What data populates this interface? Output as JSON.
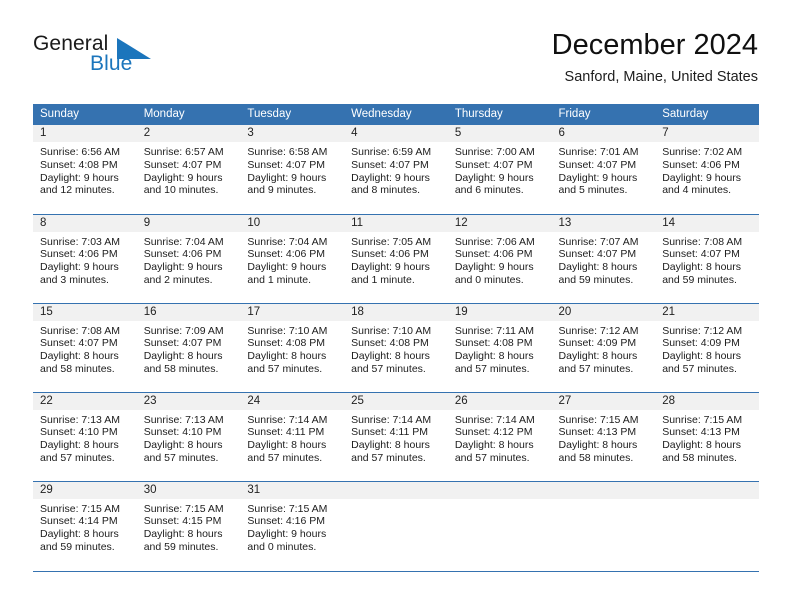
{
  "brand": {
    "name_part1": "General",
    "name_part2": "Blue",
    "mark": "triangle-logo-icon"
  },
  "header": {
    "month_title": "December 2024",
    "location": "Sanford, Maine, United States"
  },
  "colors": {
    "header_blue": "#3572b0",
    "band_gray": "#f1f1f1",
    "brand_blue": "#1b75bc",
    "text": "#1c1c1c"
  },
  "weekdays": [
    "Sunday",
    "Monday",
    "Tuesday",
    "Wednesday",
    "Thursday",
    "Friday",
    "Saturday"
  ],
  "weeks": [
    [
      {
        "day": "1",
        "sunrise": "Sunrise: 6:56 AM",
        "sunset": "Sunset: 4:08 PM",
        "daylight_line1": "Daylight: 9 hours",
        "daylight_line2": "and 12 minutes."
      },
      {
        "day": "2",
        "sunrise": "Sunrise: 6:57 AM",
        "sunset": "Sunset: 4:07 PM",
        "daylight_line1": "Daylight: 9 hours",
        "daylight_line2": "and 10 minutes."
      },
      {
        "day": "3",
        "sunrise": "Sunrise: 6:58 AM",
        "sunset": "Sunset: 4:07 PM",
        "daylight_line1": "Daylight: 9 hours",
        "daylight_line2": "and 9 minutes."
      },
      {
        "day": "4",
        "sunrise": "Sunrise: 6:59 AM",
        "sunset": "Sunset: 4:07 PM",
        "daylight_line1": "Daylight: 9 hours",
        "daylight_line2": "and 8 minutes."
      },
      {
        "day": "5",
        "sunrise": "Sunrise: 7:00 AM",
        "sunset": "Sunset: 4:07 PM",
        "daylight_line1": "Daylight: 9 hours",
        "daylight_line2": "and 6 minutes."
      },
      {
        "day": "6",
        "sunrise": "Sunrise: 7:01 AM",
        "sunset": "Sunset: 4:07 PM",
        "daylight_line1": "Daylight: 9 hours",
        "daylight_line2": "and 5 minutes."
      },
      {
        "day": "7",
        "sunrise": "Sunrise: 7:02 AM",
        "sunset": "Sunset: 4:06 PM",
        "daylight_line1": "Daylight: 9 hours",
        "daylight_line2": "and 4 minutes."
      }
    ],
    [
      {
        "day": "8",
        "sunrise": "Sunrise: 7:03 AM",
        "sunset": "Sunset: 4:06 PM",
        "daylight_line1": "Daylight: 9 hours",
        "daylight_line2": "and 3 minutes."
      },
      {
        "day": "9",
        "sunrise": "Sunrise: 7:04 AM",
        "sunset": "Sunset: 4:06 PM",
        "daylight_line1": "Daylight: 9 hours",
        "daylight_line2": "and 2 minutes."
      },
      {
        "day": "10",
        "sunrise": "Sunrise: 7:04 AM",
        "sunset": "Sunset: 4:06 PM",
        "daylight_line1": "Daylight: 9 hours",
        "daylight_line2": "and 1 minute."
      },
      {
        "day": "11",
        "sunrise": "Sunrise: 7:05 AM",
        "sunset": "Sunset: 4:06 PM",
        "daylight_line1": "Daylight: 9 hours",
        "daylight_line2": "and 1 minute."
      },
      {
        "day": "12",
        "sunrise": "Sunrise: 7:06 AM",
        "sunset": "Sunset: 4:06 PM",
        "daylight_line1": "Daylight: 9 hours",
        "daylight_line2": "and 0 minutes."
      },
      {
        "day": "13",
        "sunrise": "Sunrise: 7:07 AM",
        "sunset": "Sunset: 4:07 PM",
        "daylight_line1": "Daylight: 8 hours",
        "daylight_line2": "and 59 minutes."
      },
      {
        "day": "14",
        "sunrise": "Sunrise: 7:08 AM",
        "sunset": "Sunset: 4:07 PM",
        "daylight_line1": "Daylight: 8 hours",
        "daylight_line2": "and 59 minutes."
      }
    ],
    [
      {
        "day": "15",
        "sunrise": "Sunrise: 7:08 AM",
        "sunset": "Sunset: 4:07 PM",
        "daylight_line1": "Daylight: 8 hours",
        "daylight_line2": "and 58 minutes."
      },
      {
        "day": "16",
        "sunrise": "Sunrise: 7:09 AM",
        "sunset": "Sunset: 4:07 PM",
        "daylight_line1": "Daylight: 8 hours",
        "daylight_line2": "and 58 minutes."
      },
      {
        "day": "17",
        "sunrise": "Sunrise: 7:10 AM",
        "sunset": "Sunset: 4:08 PM",
        "daylight_line1": "Daylight: 8 hours",
        "daylight_line2": "and 57 minutes."
      },
      {
        "day": "18",
        "sunrise": "Sunrise: 7:10 AM",
        "sunset": "Sunset: 4:08 PM",
        "daylight_line1": "Daylight: 8 hours",
        "daylight_line2": "and 57 minutes."
      },
      {
        "day": "19",
        "sunrise": "Sunrise: 7:11 AM",
        "sunset": "Sunset: 4:08 PM",
        "daylight_line1": "Daylight: 8 hours",
        "daylight_line2": "and 57 minutes."
      },
      {
        "day": "20",
        "sunrise": "Sunrise: 7:12 AM",
        "sunset": "Sunset: 4:09 PM",
        "daylight_line1": "Daylight: 8 hours",
        "daylight_line2": "and 57 minutes."
      },
      {
        "day": "21",
        "sunrise": "Sunrise: 7:12 AM",
        "sunset": "Sunset: 4:09 PM",
        "daylight_line1": "Daylight: 8 hours",
        "daylight_line2": "and 57 minutes."
      }
    ],
    [
      {
        "day": "22",
        "sunrise": "Sunrise: 7:13 AM",
        "sunset": "Sunset: 4:10 PM",
        "daylight_line1": "Daylight: 8 hours",
        "daylight_line2": "and 57 minutes."
      },
      {
        "day": "23",
        "sunrise": "Sunrise: 7:13 AM",
        "sunset": "Sunset: 4:10 PM",
        "daylight_line1": "Daylight: 8 hours",
        "daylight_line2": "and 57 minutes."
      },
      {
        "day": "24",
        "sunrise": "Sunrise: 7:14 AM",
        "sunset": "Sunset: 4:11 PM",
        "daylight_line1": "Daylight: 8 hours",
        "daylight_line2": "and 57 minutes."
      },
      {
        "day": "25",
        "sunrise": "Sunrise: 7:14 AM",
        "sunset": "Sunset: 4:11 PM",
        "daylight_line1": "Daylight: 8 hours",
        "daylight_line2": "and 57 minutes."
      },
      {
        "day": "26",
        "sunrise": "Sunrise: 7:14 AM",
        "sunset": "Sunset: 4:12 PM",
        "daylight_line1": "Daylight: 8 hours",
        "daylight_line2": "and 57 minutes."
      },
      {
        "day": "27",
        "sunrise": "Sunrise: 7:15 AM",
        "sunset": "Sunset: 4:13 PM",
        "daylight_line1": "Daylight: 8 hours",
        "daylight_line2": "and 58 minutes."
      },
      {
        "day": "28",
        "sunrise": "Sunrise: 7:15 AM",
        "sunset": "Sunset: 4:13 PM",
        "daylight_line1": "Daylight: 8 hours",
        "daylight_line2": "and 58 minutes."
      }
    ],
    [
      {
        "day": "29",
        "sunrise": "Sunrise: 7:15 AM",
        "sunset": "Sunset: 4:14 PM",
        "daylight_line1": "Daylight: 8 hours",
        "daylight_line2": "and 59 minutes."
      },
      {
        "day": "30",
        "sunrise": "Sunrise: 7:15 AM",
        "sunset": "Sunset: 4:15 PM",
        "daylight_line1": "Daylight: 8 hours",
        "daylight_line2": "and 59 minutes."
      },
      {
        "day": "31",
        "sunrise": "Sunrise: 7:15 AM",
        "sunset": "Sunset: 4:16 PM",
        "daylight_line1": "Daylight: 9 hours",
        "daylight_line2": "and 0 minutes."
      },
      {
        "day": "",
        "sunrise": "",
        "sunset": "",
        "daylight_line1": "",
        "daylight_line2": ""
      },
      {
        "day": "",
        "sunrise": "",
        "sunset": "",
        "daylight_line1": "",
        "daylight_line2": ""
      },
      {
        "day": "",
        "sunrise": "",
        "sunset": "",
        "daylight_line1": "",
        "daylight_line2": ""
      },
      {
        "day": "",
        "sunrise": "",
        "sunset": "",
        "daylight_line1": "",
        "daylight_line2": ""
      }
    ]
  ]
}
